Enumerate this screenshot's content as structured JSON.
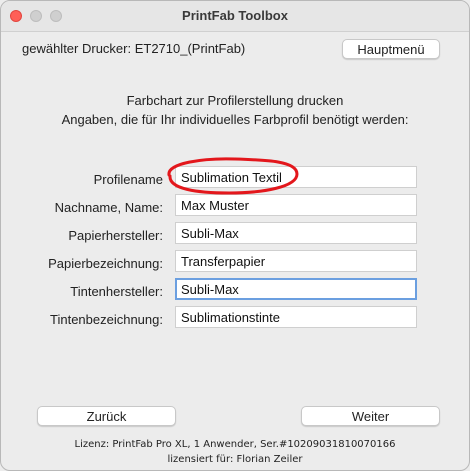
{
  "window": {
    "title": "PrintFab Toolbox"
  },
  "header": {
    "printer_label": "gewählter Drucker: ET2710_(PrintFab)",
    "main_menu_label": "Hauptmenü"
  },
  "intro": {
    "line1": "Farbchart zur Profilerstellung drucken",
    "line2": "Angaben, die für Ihr individuelles Farbprofil benötigt werden:"
  },
  "form": {
    "fields": [
      {
        "label": "Profilename",
        "value": "Sublimation Textil"
      },
      {
        "label": "Nachname, Name:",
        "value": "Max Muster"
      },
      {
        "label": "Papierhersteller:",
        "value": "Subli-Max"
      },
      {
        "label": "Papierbezeichnung:",
        "value": "Transferpapier"
      },
      {
        "label": "Tintenhersteller:",
        "value": "Subli-Max"
      },
      {
        "label": "Tintenbezeichnung:",
        "value": "Sublimationstinte"
      }
    ]
  },
  "nav": {
    "back_label": "Zurück",
    "next_label": "Weiter"
  },
  "footer": {
    "license_line": "Lizenz: PrintFab Pro XL, 1 Anwender, Ser.#10209031810070166",
    "licensed_for": "lizensiert für: Florian Zeiler"
  },
  "colors": {
    "focus_ring": "#6b9fe0",
    "annotation": "#e3171c"
  }
}
